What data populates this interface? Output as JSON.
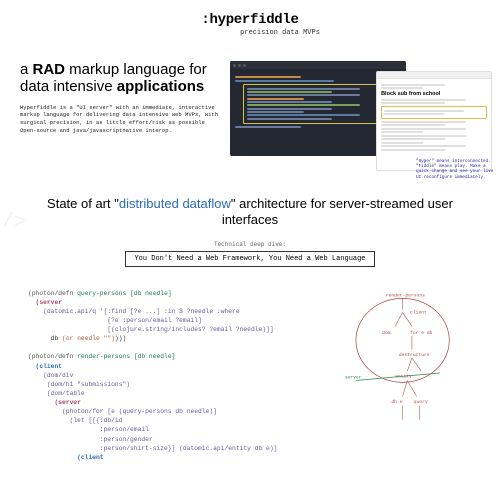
{
  "header": {
    "logo": ":hyperfiddle",
    "tagline": "precision data MVPs"
  },
  "section1": {
    "headline_pre": "a ",
    "headline_rad": "RAD",
    "headline_mid": " markup language for data intensive ",
    "headline_apps": "applications",
    "description": "Hyperfiddle is a \"UI server\" with an immediate, interactive markup language for delivering data intensive web MVPs, with surgical precision, in as little effort/risk as possible Open-source and java/javascriptnative interop.",
    "browser_form_title": "Block sub from school",
    "annotation_text": "\"Hyper\" means interconnected. \"Fiddle\" means play. Make a quick change and see your live UI reconfigure immediately."
  },
  "section2": {
    "headline_pre": "State of art \"",
    "headline_quoted": "distributed dataflow",
    "headline_post": "\" architecture for server-streamed user interfaces",
    "deepdive_label": "Technical deep dive:",
    "deepdive_button": "You Don't Need a Web Framework, You Need a Web Language",
    "watermark": "/>"
  },
  "section3": {
    "code": {
      "l1a": "(photon/defn",
      "l1b": " query-persons [db needle]",
      "l2": "  (server",
      "l3a": "    (datomic.api/q '[:find [?e ...] :in $ ?needle :where",
      "l4a": "                     [?e :person/email ?email]",
      "l5a": "                     [(clojure.string/includes? ?email ?needle)]]",
      "l6a": "      db ",
      "l6b": "(or needle \"\")",
      "l6c": ")))",
      "blank": "",
      "l7a": "(photon/defn",
      "l7b": " render-persons [db needle]",
      "l8": "  (client",
      "l9a": "    (dom/div",
      "l10a": "     (dom/h1 \"submissions\")",
      "l11a": "     (dom/table",
      "l12": "       (server",
      "l13a": "         (photon/for [e (query-persons db needle)]",
      "l14a": "           (let [[{:db/id",
      "l15a": "                   :person/email",
      "l16a": "                   :person/gender",
      "l17a": "                   :person/shirt-size}] (datomic.api/entity db e)]",
      "l18": "             (client"
    },
    "diagram": {
      "labels": {
        "render": "render-persons",
        "client": "client",
        "div": "dom",
        "for": "for e db",
        "destructure": "destructure",
        "entity": "entity",
        "server": "server",
        "db": "db e",
        "q": "query"
      }
    }
  }
}
